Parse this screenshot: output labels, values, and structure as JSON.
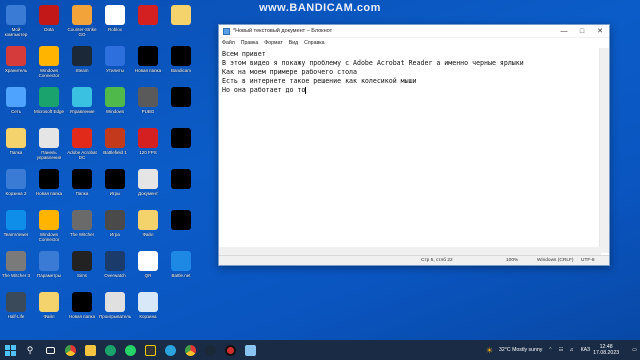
{
  "watermark": "www.BANDICAM.com",
  "desktop_icons": [
    {
      "label": "Мой компьютер",
      "color": "#3a7bd5"
    },
    {
      "label": "Dota",
      "color": "#c21818"
    },
    {
      "label": "Counter-Strike GO",
      "color": "#f2a33a"
    },
    {
      "label": "Roblox",
      "color": "#ffffff"
    },
    {
      "label": "",
      "color": "#d42020"
    },
    {
      "label": "",
      "color": "#f5d36c"
    },
    {
      "label": "Хранитель",
      "color": "#d53b3b"
    },
    {
      "label": "Windows Connector",
      "color": "#ffb400"
    },
    {
      "label": "Steam",
      "color": "#1b2838"
    },
    {
      "label": "Утилиты",
      "color": "#2d6fdc"
    },
    {
      "label": "Новая папка",
      "color": "#000000"
    },
    {
      "label": "Bandicam",
      "color": "#000000"
    },
    {
      "label": "Сеть",
      "color": "#4da3ff"
    },
    {
      "label": "Microsoft Edge",
      "color": "#1aa36c"
    },
    {
      "label": "Управление",
      "color": "#3ac0e0"
    },
    {
      "label": "Windows",
      "color": "#4fba4a"
    },
    {
      "label": "PUBG",
      "color": "#5a5a5a"
    },
    {
      "label": "",
      "color": "#000000"
    },
    {
      "label": "Папка",
      "color": "#f5d36c"
    },
    {
      "label": "Панель управления",
      "color": "#e5e5e5"
    },
    {
      "label": "Adobe Acrobat DC",
      "color": "#e22a1b"
    },
    {
      "label": "Battlefield 1",
      "color": "#c23a1b"
    },
    {
      "label": "120 FPS",
      "color": "#d42020"
    },
    {
      "label": "",
      "color": "#000000"
    },
    {
      "label": "Корзина 2",
      "color": "#3a7bd5"
    },
    {
      "label": "Новая папка",
      "color": "#000000"
    },
    {
      "label": "Папка",
      "color": "#000000"
    },
    {
      "label": "Игры",
      "color": "#000000"
    },
    {
      "label": "Документ",
      "color": "#e5e5e5"
    },
    {
      "label": "",
      "color": "#000000"
    },
    {
      "label": "TeamViewer",
      "color": "#0e8ee9"
    },
    {
      "label": "Windows Connector",
      "color": "#ffb400"
    },
    {
      "label": "The Witcher",
      "color": "#6a6a6a"
    },
    {
      "label": "Игра",
      "color": "#4a4a4a"
    },
    {
      "label": "Файл",
      "color": "#f5d36c"
    },
    {
      "label": "",
      "color": "#000000"
    },
    {
      "label": "The Witcher 3",
      "color": "#7a7a7a"
    },
    {
      "label": "Параметры",
      "color": "#3a7bd5"
    },
    {
      "label": "Sims",
      "color": "#222222"
    },
    {
      "label": "Overwatch",
      "color": "#1b3b6a"
    },
    {
      "label": "QR",
      "color": "#ffffff"
    },
    {
      "label": "Battle.net",
      "color": "#1e88e5"
    },
    {
      "label": "Half-Life",
      "color": "#3a4a5a"
    },
    {
      "label": "Файл",
      "color": "#f5d36c"
    },
    {
      "label": "Новая папка",
      "color": "#000000"
    },
    {
      "label": "Проигрыватель",
      "color": "#e0e0e0"
    },
    {
      "label": "Корзина",
      "color": "#d8e8f8"
    }
  ],
  "notepad": {
    "title": "*Новый текстовый документ – Блокнот",
    "menu": [
      "Файл",
      "Правка",
      "Формат",
      "Вид",
      "Справка"
    ],
    "lines": [
      "Всем привет",
      "В этом видео я покажу проблему с Adobe Acrobat Reader а именно черные ярлыки",
      "Как на моем примере рабочего стола",
      "Есть в интернете такое решение как колесикой мыши",
      "Но она работает до то"
    ],
    "status": {
      "position": "Стр 5, стлб 22",
      "zoom": "100%",
      "line_ending": "Windows (CRLF)",
      "encoding": "UTF-8"
    }
  },
  "taskbar": {
    "weather": "32°C  Mostly sunny",
    "lang": "КАЗ",
    "time": "12:48",
    "date": "17.08.2023"
  }
}
